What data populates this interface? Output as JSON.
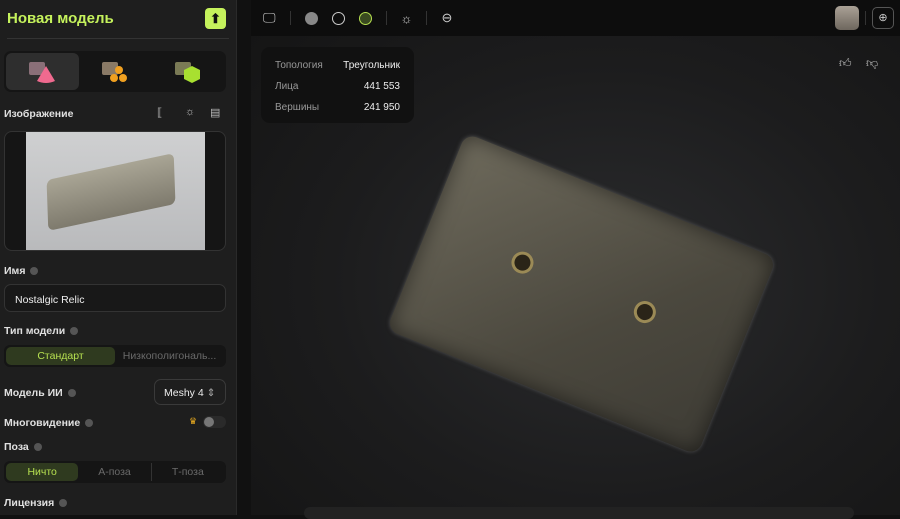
{
  "sidebar": {
    "title": "Новая модель",
    "modes": [
      "image-to-3d",
      "multi-image-to-3d",
      "text-to-3d"
    ],
    "image_label": "Изображение",
    "name_label": "Имя",
    "name_value": "Nostalgic Relic",
    "model_type_label": "Тип модели",
    "model_types": [
      "Стандарт",
      "Низкополигональ..."
    ],
    "ai_model_label": "Модель ИИ",
    "ai_model_value": "Meshy 4",
    "multiview_label": "Многовидение",
    "multiview_on": false,
    "pose_label": "Поза",
    "poses": [
      "Ничто",
      "А-поза",
      "Т-поза"
    ],
    "license_label": "Лицензия"
  },
  "stats": {
    "rows": [
      {
        "k": "Топология",
        "v": "Треугольник"
      },
      {
        "k": "Лица",
        "v": "441 553"
      },
      {
        "k": "Вершины",
        "v": "241 950"
      }
    ]
  },
  "colors": {
    "accent": "#c5f25c"
  }
}
